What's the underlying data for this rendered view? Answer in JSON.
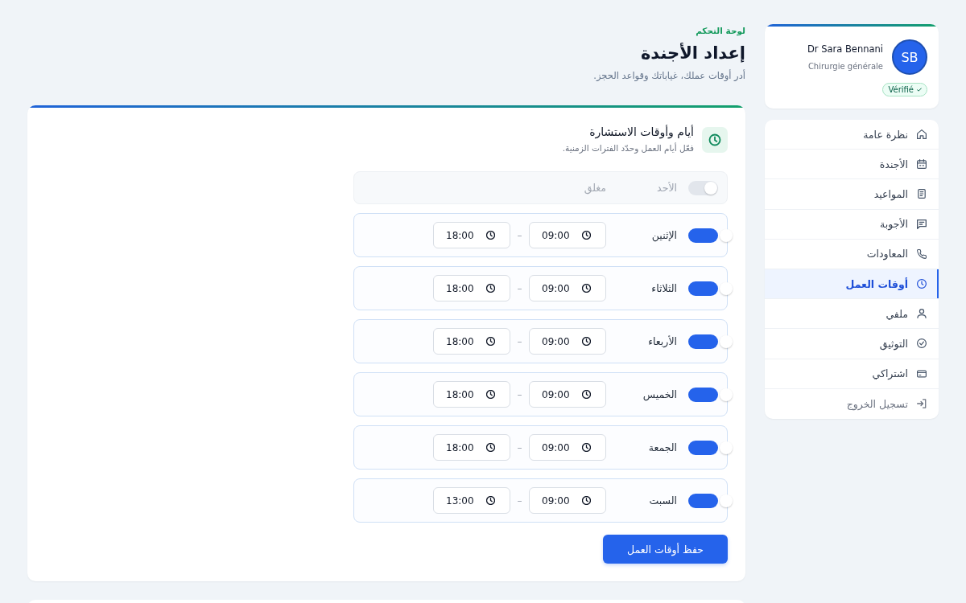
{
  "sidebar": {
    "profile": {
      "name": "Dr Sara Bennani",
      "specialty": "Chirurgie générale",
      "initials": "SB",
      "verified": true,
      "badge_label": "Vérifié"
    },
    "nav": [
      {
        "label": "نظرة عامة",
        "kind": "page",
        "selected": false
      },
      {
        "label": "الأجندة",
        "kind": "page",
        "selected": false
      },
      {
        "label": "المواعيد",
        "kind": "page",
        "selected": false
      },
      {
        "label": "الأجوبة",
        "kind": "page",
        "selected": false
      },
      {
        "label": "المعاودات",
        "kind": "page",
        "selected": false
      },
      {
        "label": "أوقات العمل",
        "kind": "page",
        "selected": true
      },
      {
        "label": "ملفي",
        "kind": "page",
        "selected": false
      },
      {
        "label": "التوثيق",
        "kind": "page",
        "selected": false
      },
      {
        "label": "اشتراكي",
        "kind": "page",
        "selected": false
      },
      {
        "label": "تسجيل الخروج",
        "kind": "logout",
        "selected": false
      }
    ]
  },
  "header": {
    "breadcrumb": "لوحة التحكم",
    "title": "إعداد الأجندة",
    "subtitle": "أدر أوقات عملك، غياباتك وقواعد الحجز."
  },
  "hours_card": {
    "title": "أيام وأوقات الاستشارة",
    "subtitle": "فعّل أيام العمل وحدّد الفترات الزمنية.",
    "separator": "–",
    "days": [
      {
        "day": "الأحد",
        "enabled": false,
        "closed_label": "مغلق"
      },
      {
        "day": "الإثنين",
        "enabled": true,
        "start": "09:00",
        "end": "18:00"
      },
      {
        "day": "الثلاثاء",
        "enabled": true,
        "start": "09:00",
        "end": "18:00"
      },
      {
        "day": "الأربعاء",
        "enabled": true,
        "start": "09:00",
        "end": "18:00"
      },
      {
        "day": "الخميس",
        "enabled": true,
        "start": "09:00",
        "end": "18:00"
      },
      {
        "day": "الجمعة",
        "enabled": true,
        "start": "09:00",
        "end": "18:00"
      },
      {
        "day": "السبت",
        "enabled": true,
        "start": "09:00",
        "end": "13:00"
      }
    ],
    "save_button": "حفظ أوقات العمل"
  }
}
